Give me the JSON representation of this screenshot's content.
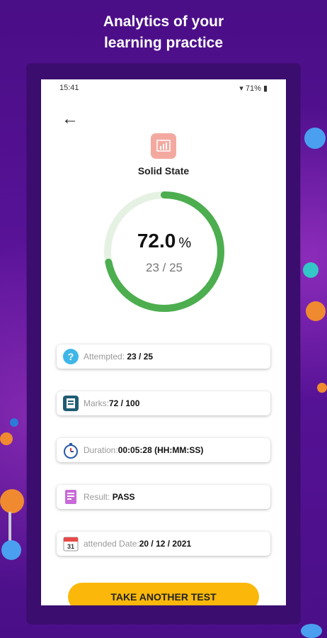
{
  "headline": {
    "line1": "Analytics of your",
    "line2": "learning practice"
  },
  "status_bar": {
    "time": "15:41",
    "right": "71%"
  },
  "subject": {
    "title": "Solid State",
    "icon": "chart-board-icon"
  },
  "result": {
    "percent": "72.0",
    "percent_unit": "%",
    "score": "23 / 25",
    "progress_fraction": 0.72
  },
  "colors": {
    "progress": "#4cae4f",
    "track": "#e5f2e3",
    "button": "#fbb80a",
    "background": "#4a0e86"
  },
  "cards": [
    {
      "label": "Attempted:",
      "value": "23 / 25",
      "icon": "question-icon"
    },
    {
      "label": "Marks:",
      "value": "72 / 100",
      "icon": "marks-icon"
    },
    {
      "label": "Duration:",
      "value": "00:05:28 (HH:MM:SS)",
      "icon": "stopwatch-icon"
    },
    {
      "label": "Result:",
      "value": "PASS",
      "icon": "result-icon"
    },
    {
      "label": "attended Date:",
      "value": "20 / 12 / 2021",
      "icon": "calendar-icon"
    }
  ],
  "cta": {
    "label": "TAKE ANOTHER TEST"
  }
}
